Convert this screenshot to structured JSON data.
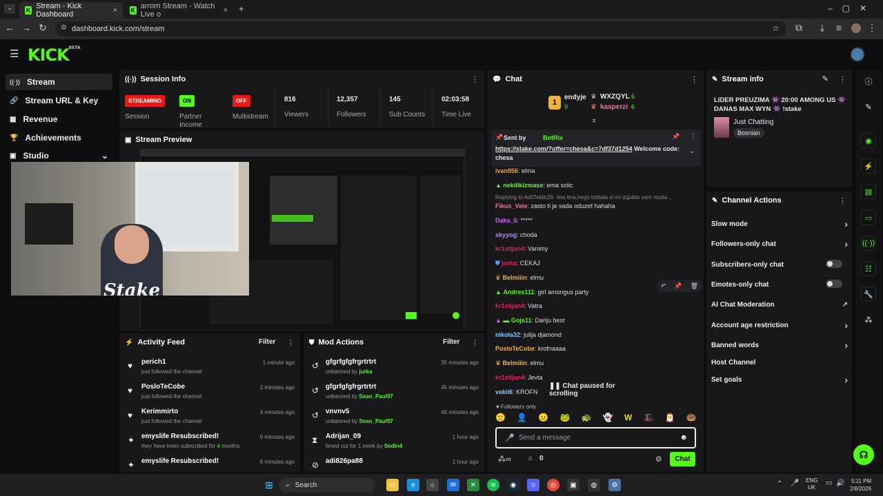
{
  "browser": {
    "tabs": [
      {
        "label": "Stream - Kick Dashboard",
        "close": "×"
      },
      {
        "label": "arrom Stream - Watch Live o",
        "close": "×"
      }
    ],
    "url": "dashboard.kick.com/stream",
    "new_tab": "+"
  },
  "app": {
    "logo": "KICK",
    "logo_sup": "BETA"
  },
  "sidebar": {
    "items": [
      {
        "label": "Stream",
        "icon": "((·))"
      },
      {
        "label": "Stream URL & Key",
        "icon": "🔗"
      },
      {
        "label": "Revenue",
        "icon": "▦"
      },
      {
        "label": "Achievements",
        "icon": "🏆"
      },
      {
        "label": "Studio",
        "icon": "▣",
        "chevron": "⌄"
      }
    ]
  },
  "session": {
    "title": "Session Info",
    "streaming": "STREAMING",
    "session_label": "Session",
    "on": "ON",
    "partner_label": "Partner Income",
    "off": "OFF",
    "multistream_label": "Multistream",
    "viewers": "816",
    "viewers_label": "Viewers",
    "followers": "12,357",
    "followers_label": "Followers",
    "subs": "145",
    "subs_label": "Sub Counts",
    "time": "02:03:58",
    "time_label": "Time Live"
  },
  "preview": {
    "title": "Stream Preview",
    "watermark": "Stake"
  },
  "activity": {
    "title": "Activity Feed",
    "filter": "Filter",
    "rows": [
      {
        "name": "perich1",
        "sub": "just followed the channel",
        "time": "1 minute ago"
      },
      {
        "name": "PosloTeCobe",
        "sub": "just followed the channel",
        "time": "2 minutes ago"
      },
      {
        "name": "Kerimmirto",
        "sub": "just followed the channel",
        "time": "4 minutes ago"
      },
      {
        "name": "emyslife Resubscribed!",
        "sub_pre": "they have been subscribed for ",
        "sub_num": "4",
        "sub_post": " months",
        "time": "6 minutes ago"
      },
      {
        "name": "emyslife Resubscribed!",
        "sub": "",
        "time": "6 minutes ago"
      }
    ]
  },
  "mod": {
    "title": "Mod Actions",
    "filter": "Filter",
    "rows": [
      {
        "name": "gfgrfgfgfrgrtrtrt",
        "sub_pre": "unbanned by ",
        "by": "jurka",
        "time": "35 minutes ago"
      },
      {
        "name": "gfgrfgfgfrgrtrtrt",
        "sub_pre": "unbanned by ",
        "by": "Sean_Paul97",
        "time": "45 minutes ago"
      },
      {
        "name": "vnvnv5",
        "sub_pre": "unbanned by ",
        "by": "Sean_Paul97",
        "time": "46 minutes ago"
      },
      {
        "name": "Adrijan_09",
        "sub_pre": "timed out for 1 week by ",
        "by": "Sedin4",
        "time": "1 hour ago"
      },
      {
        "name": "adi826pa88",
        "sub_pre": "",
        "by": "",
        "time": "1 hour ago"
      }
    ]
  },
  "chat": {
    "title": "Chat",
    "top": [
      {
        "rank": "1",
        "name": "endyje",
        "count": "9"
      },
      {
        "rank": "",
        "name": "WXZQYL",
        "count": "6"
      },
      {
        "rank": "",
        "name": "kasperzi",
        "count": "6"
      }
    ],
    "pinned": {
      "sent_by": "Sent by",
      "sender": "BotRix",
      "link": "https://stake.com/?offer=chesa&c=7df37d1254",
      "text": " Welcome code: chesa"
    },
    "reply_note": "Replying to AdilTeklic26: ima ima,nego trebala si mi izgubio sam moda...",
    "messages": [
      {
        "user": "ivan856",
        "text": ": elma",
        "color": "#e8a23a"
      },
      {
        "user": "nekilikizmase",
        "text": ": ema solic",
        "color": "#53fc18"
      },
      {
        "user": "Fikus_Vale",
        "text": ": zasto ti je sada oduzet hahaha",
        "color": "#ff6b9e"
      },
      {
        "user": "Daka_6",
        "text": ": *****",
        "color": "#d45cff"
      },
      {
        "user": "skyyog",
        "text": ": choda",
        "color": "#b48cff"
      },
      {
        "user": "kr1stijan4",
        "text": ": Vanimy",
        "color": "#e0245e"
      },
      {
        "user": "jurka",
        "text": ": CEKAJ",
        "color": "#e0245e"
      },
      {
        "user": "Belmiiin",
        "text": ": elmu",
        "color": "#f0b33c"
      },
      {
        "user": "Andrex111",
        "text": ": girl amongus party",
        "color": "#53fc18"
      },
      {
        "user": "kr1stijan4",
        "text": ": Vatra",
        "color": "#e0245e"
      },
      {
        "user": "Goja11",
        "text": ": Dariju best",
        "color": "#53fc18"
      },
      {
        "user": "nikola32",
        "text": ": julija djamond",
        "color": "#7ecbff"
      },
      {
        "user": "PosloTeCobe",
        "text": ": krofnaaaa",
        "color": "#f0b33c"
      },
      {
        "user": "Belmiiin",
        "text": ": elmu",
        "color": "#f0b33c"
      },
      {
        "user": "kr1stijan4",
        "text": ": Jevta",
        "color": "#e0245e"
      },
      {
        "user": "vekii6",
        "text": ": KROFN",
        "color": "#7ecbff"
      }
    ],
    "paused": "Chat paused for scrolling",
    "followers_only": "Followers only",
    "placeholder": "Send a message",
    "send": "Chat",
    "count": "0"
  },
  "stream_info": {
    "title": "Stream info",
    "headline": "LIDER PREUZIMA 👾 20:00 AMONG US 👾 DANAS MAX WYN 👾 !stake",
    "category": "Just Chatting",
    "tag": "Bosnian"
  },
  "channel_actions": {
    "title": "Channel Actions",
    "items": [
      {
        "label": "Slow mode",
        "control": "arrow"
      },
      {
        "label": "Followers-only chat",
        "control": "arrow"
      },
      {
        "label": "Subscribers-only chat",
        "control": "toggle"
      },
      {
        "label": "Emotes-only chat",
        "control": "toggle"
      },
      {
        "label": "AI Chat Moderation",
        "control": "ext"
      },
      {
        "label": "Account age restriction",
        "control": "arrow"
      },
      {
        "label": "Banned words",
        "control": "arrow"
      },
      {
        "label": "Host Channel",
        "control": "none"
      },
      {
        "label": "Set goals",
        "control": "arrow"
      }
    ]
  },
  "taskbar": {
    "search": "Search",
    "lang": "ENG",
    "region": "UK",
    "time": "5:11 PM",
    "date": "2/8/2026"
  },
  "colors": {
    "accent": "#53fc18",
    "streaming": "#e91916",
    "panel": "#18181b"
  }
}
